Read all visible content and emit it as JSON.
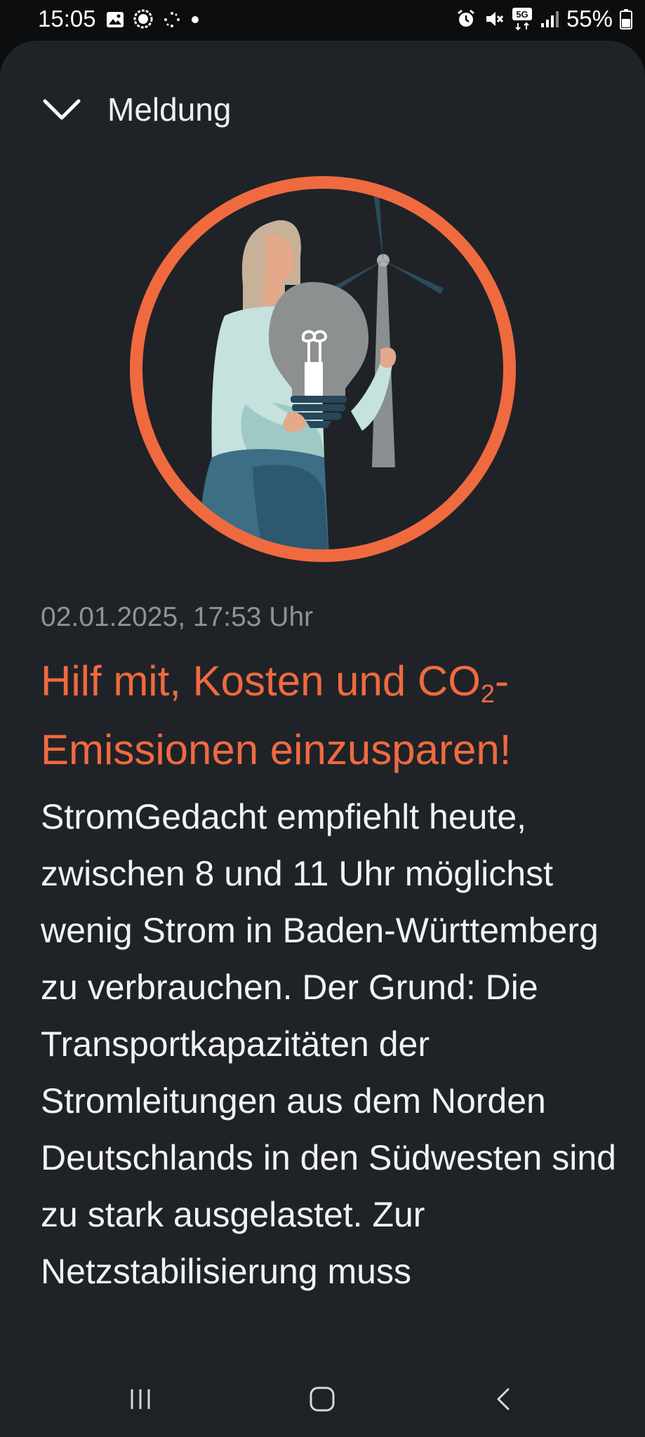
{
  "status_bar": {
    "time": "15:05",
    "battery": "55%",
    "network": "5G",
    "icons": [
      "gallery-icon",
      "signal-messenger-icon",
      "sparkle-icon",
      "dot-icon",
      "alarm-icon",
      "mute-icon",
      "5g-icon",
      "signal-bars-icon",
      "battery-icon"
    ]
  },
  "header": {
    "title": "Meldung",
    "back_icon": "chevron-down-icon"
  },
  "colors": {
    "accent": "#f06a40",
    "sheet_background": "#1f2327",
    "date_gray": "#8e9397"
  },
  "article": {
    "date": "02.01.2025, 17:53 Uhr",
    "headline_part1": "Hilf mit, Kosten und CO",
    "headline_sub": "2",
    "headline_part2": "-",
    "headline_line2": "Emissionen einzusparen!",
    "body": "StromGedacht empfiehlt heute, zwischen 8 und 11 Uhr möglichst wenig Strom in Baden-Württemberg zu verbrauchen. Der Grund: Die Transportkapazitäten der Stromleitungen aus dem Norden Deutschlands in den Südwesten sind zu stark ausgelastet. Zur Netzstabilisierung muss"
  },
  "nav_bar": {
    "buttons": [
      "recent-apps-icon",
      "home-icon",
      "back-icon"
    ]
  }
}
